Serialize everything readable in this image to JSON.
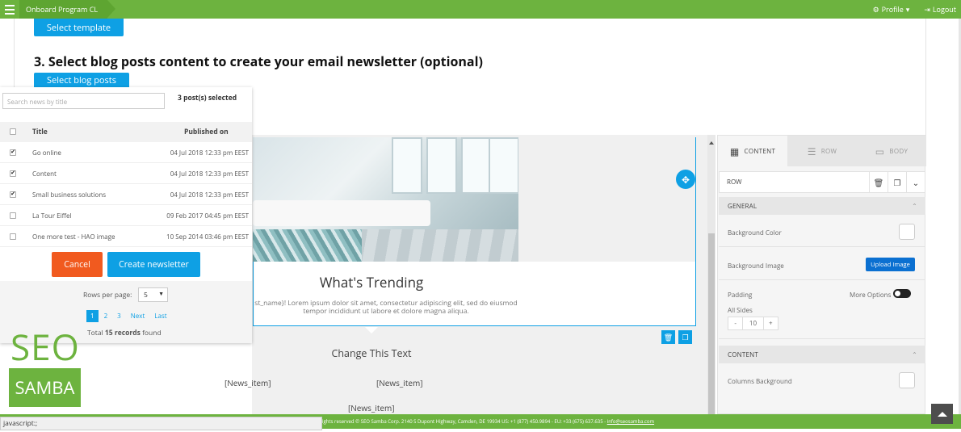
{
  "topbar": {
    "app_title": "Onboard Program CL",
    "profile": "Profile",
    "logout": "Logout"
  },
  "main": {
    "select_template": "Select template",
    "step_heading": "3. Select blog posts content to create your email newsletter (optional)",
    "select_blog_posts": "Select blog posts"
  },
  "dropdown": {
    "search_placeholder": "Search news by title",
    "selected_count": "3 post(s) selected",
    "col_title": "Title",
    "col_published": "Published on",
    "rows": [
      {
        "checked": true,
        "title": "Go online",
        "date": "04 Jul 2018 12:33 pm EEST"
      },
      {
        "checked": true,
        "title": "Content",
        "date": "04 Jul 2018 12:33 pm EEST"
      },
      {
        "checked": true,
        "title": "Small business solutions",
        "date": "04 Jul 2018 12:33 pm EEST"
      },
      {
        "checked": false,
        "title": "La Tour Eiffel",
        "date": "09 Feb 2017 04:45 pm EEST"
      },
      {
        "checked": false,
        "title": "One more test - HAO image",
        "date": "10 Sep 2014 03:46 pm EEST"
      }
    ],
    "cancel": "Cancel",
    "create": "Create newsletter",
    "rows_per_page_label": "Rows per page:",
    "rows_per_page_value": "5",
    "pages": [
      "1",
      "2",
      "3",
      "Next",
      "Last"
    ],
    "total_prefix": "Total",
    "total_count": "15 records",
    "total_suffix": "found"
  },
  "editor": {
    "trending_title": "What's Trending",
    "lorem_line1": "st_name}! Lorem ipsum dolor sit amet, consectetur adipiscing elit, sed do eiusmod",
    "lorem_line2": "tempor incididunt ut labore et dolore magna aliqua.",
    "change_text": "Change This Text",
    "news_item_1": "[News_item]",
    "news_item_2": "[News_item]",
    "news_item_3": "[News_item]"
  },
  "panel": {
    "tab_content": "CONTENT",
    "tab_row": "ROW",
    "tab_body": "BODY",
    "row_label": "ROW",
    "general": "GENERAL",
    "bg_color": "Background Color",
    "bg_image": "Background Image",
    "upload_image": "Upload Image",
    "padding": "Padding",
    "more_options": "More Options",
    "all_sides": "All Sides",
    "stepper_minus": "-",
    "stepper_value": "10",
    "stepper_plus": "+",
    "content_section": "CONTENT",
    "columns_bg": "Columns Background"
  },
  "logo": {
    "line1": "SEO",
    "line2": "SAMBA"
  },
  "footer": {
    "copyright": "ights reserved © SEO Samba Corp. 2140 S Dupont Highway, Camden, DE 19934 US: +1 (877) 450.9894 - EU: +33 (675) 637.635 - ",
    "email": "info@seosamba.com"
  },
  "status_bar": "javascript:;"
}
